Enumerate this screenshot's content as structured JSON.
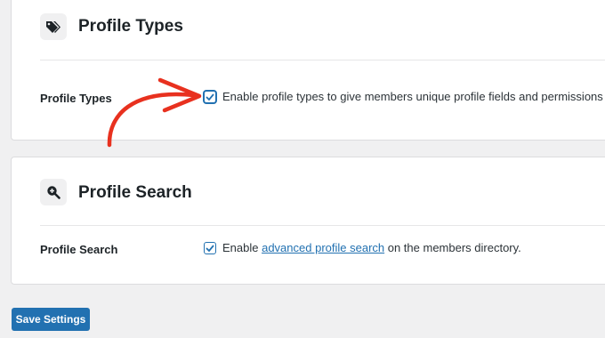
{
  "profile_types_section": {
    "title": "Profile Types",
    "icon": "tags-icon",
    "setting_label": "Profile Types",
    "checkbox_checked": true,
    "checkbox_text": "Enable profile types to give members unique profile fields and permissions"
  },
  "profile_search_section": {
    "title": "Profile Search",
    "icon": "search-plus-icon",
    "setting_label": "Profile Search",
    "checkbox_checked": true,
    "checkbox_text_before": "Enable ",
    "checkbox_link_text": "advanced profile search",
    "checkbox_text_after": " on the members directory."
  },
  "save_button_label": "Save Settings",
  "colors": {
    "accent": "#2271b1",
    "annotation_arrow": "#e8311f",
    "page_background": "#f0f0f1"
  }
}
